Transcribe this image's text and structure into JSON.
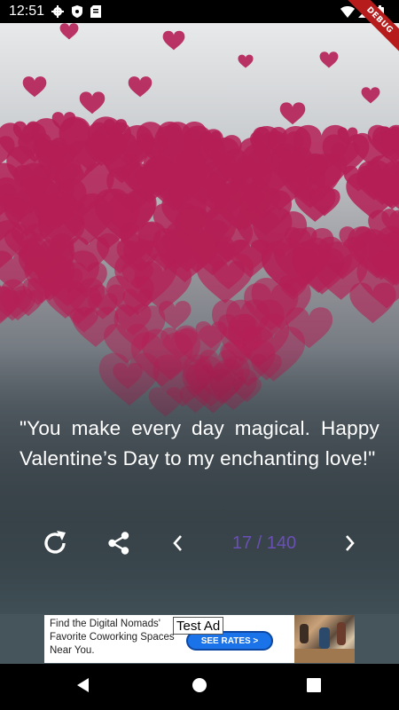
{
  "status_bar": {
    "time": "12:51",
    "left_icons": [
      "gear-icon",
      "shield-icon",
      "sim-card-icon"
    ],
    "right_icons": [
      "wifi-icon",
      "signal-icon",
      "battery-icon"
    ]
  },
  "debug_banner": {
    "label": "DEBUG"
  },
  "quote": {
    "text": "\"You make every day magical. Happy Valentine’s Day to my enchanting love!\""
  },
  "controls": {
    "counter": "17 / 140",
    "counter_color": "#6a4fb5",
    "icons": [
      "refresh-icon",
      "share-icon",
      "chevron-left-icon",
      "chevron-right-icon"
    ]
  },
  "ad": {
    "label": "Test Ad",
    "text": "Find the Digital Nomads' Favorite Coworking Spaces Near You.",
    "button": "SEE RATES >"
  },
  "colors": {
    "heart": "#b41f55",
    "background_top": "#e8e9ea",
    "background_bottom": "#44535a"
  }
}
